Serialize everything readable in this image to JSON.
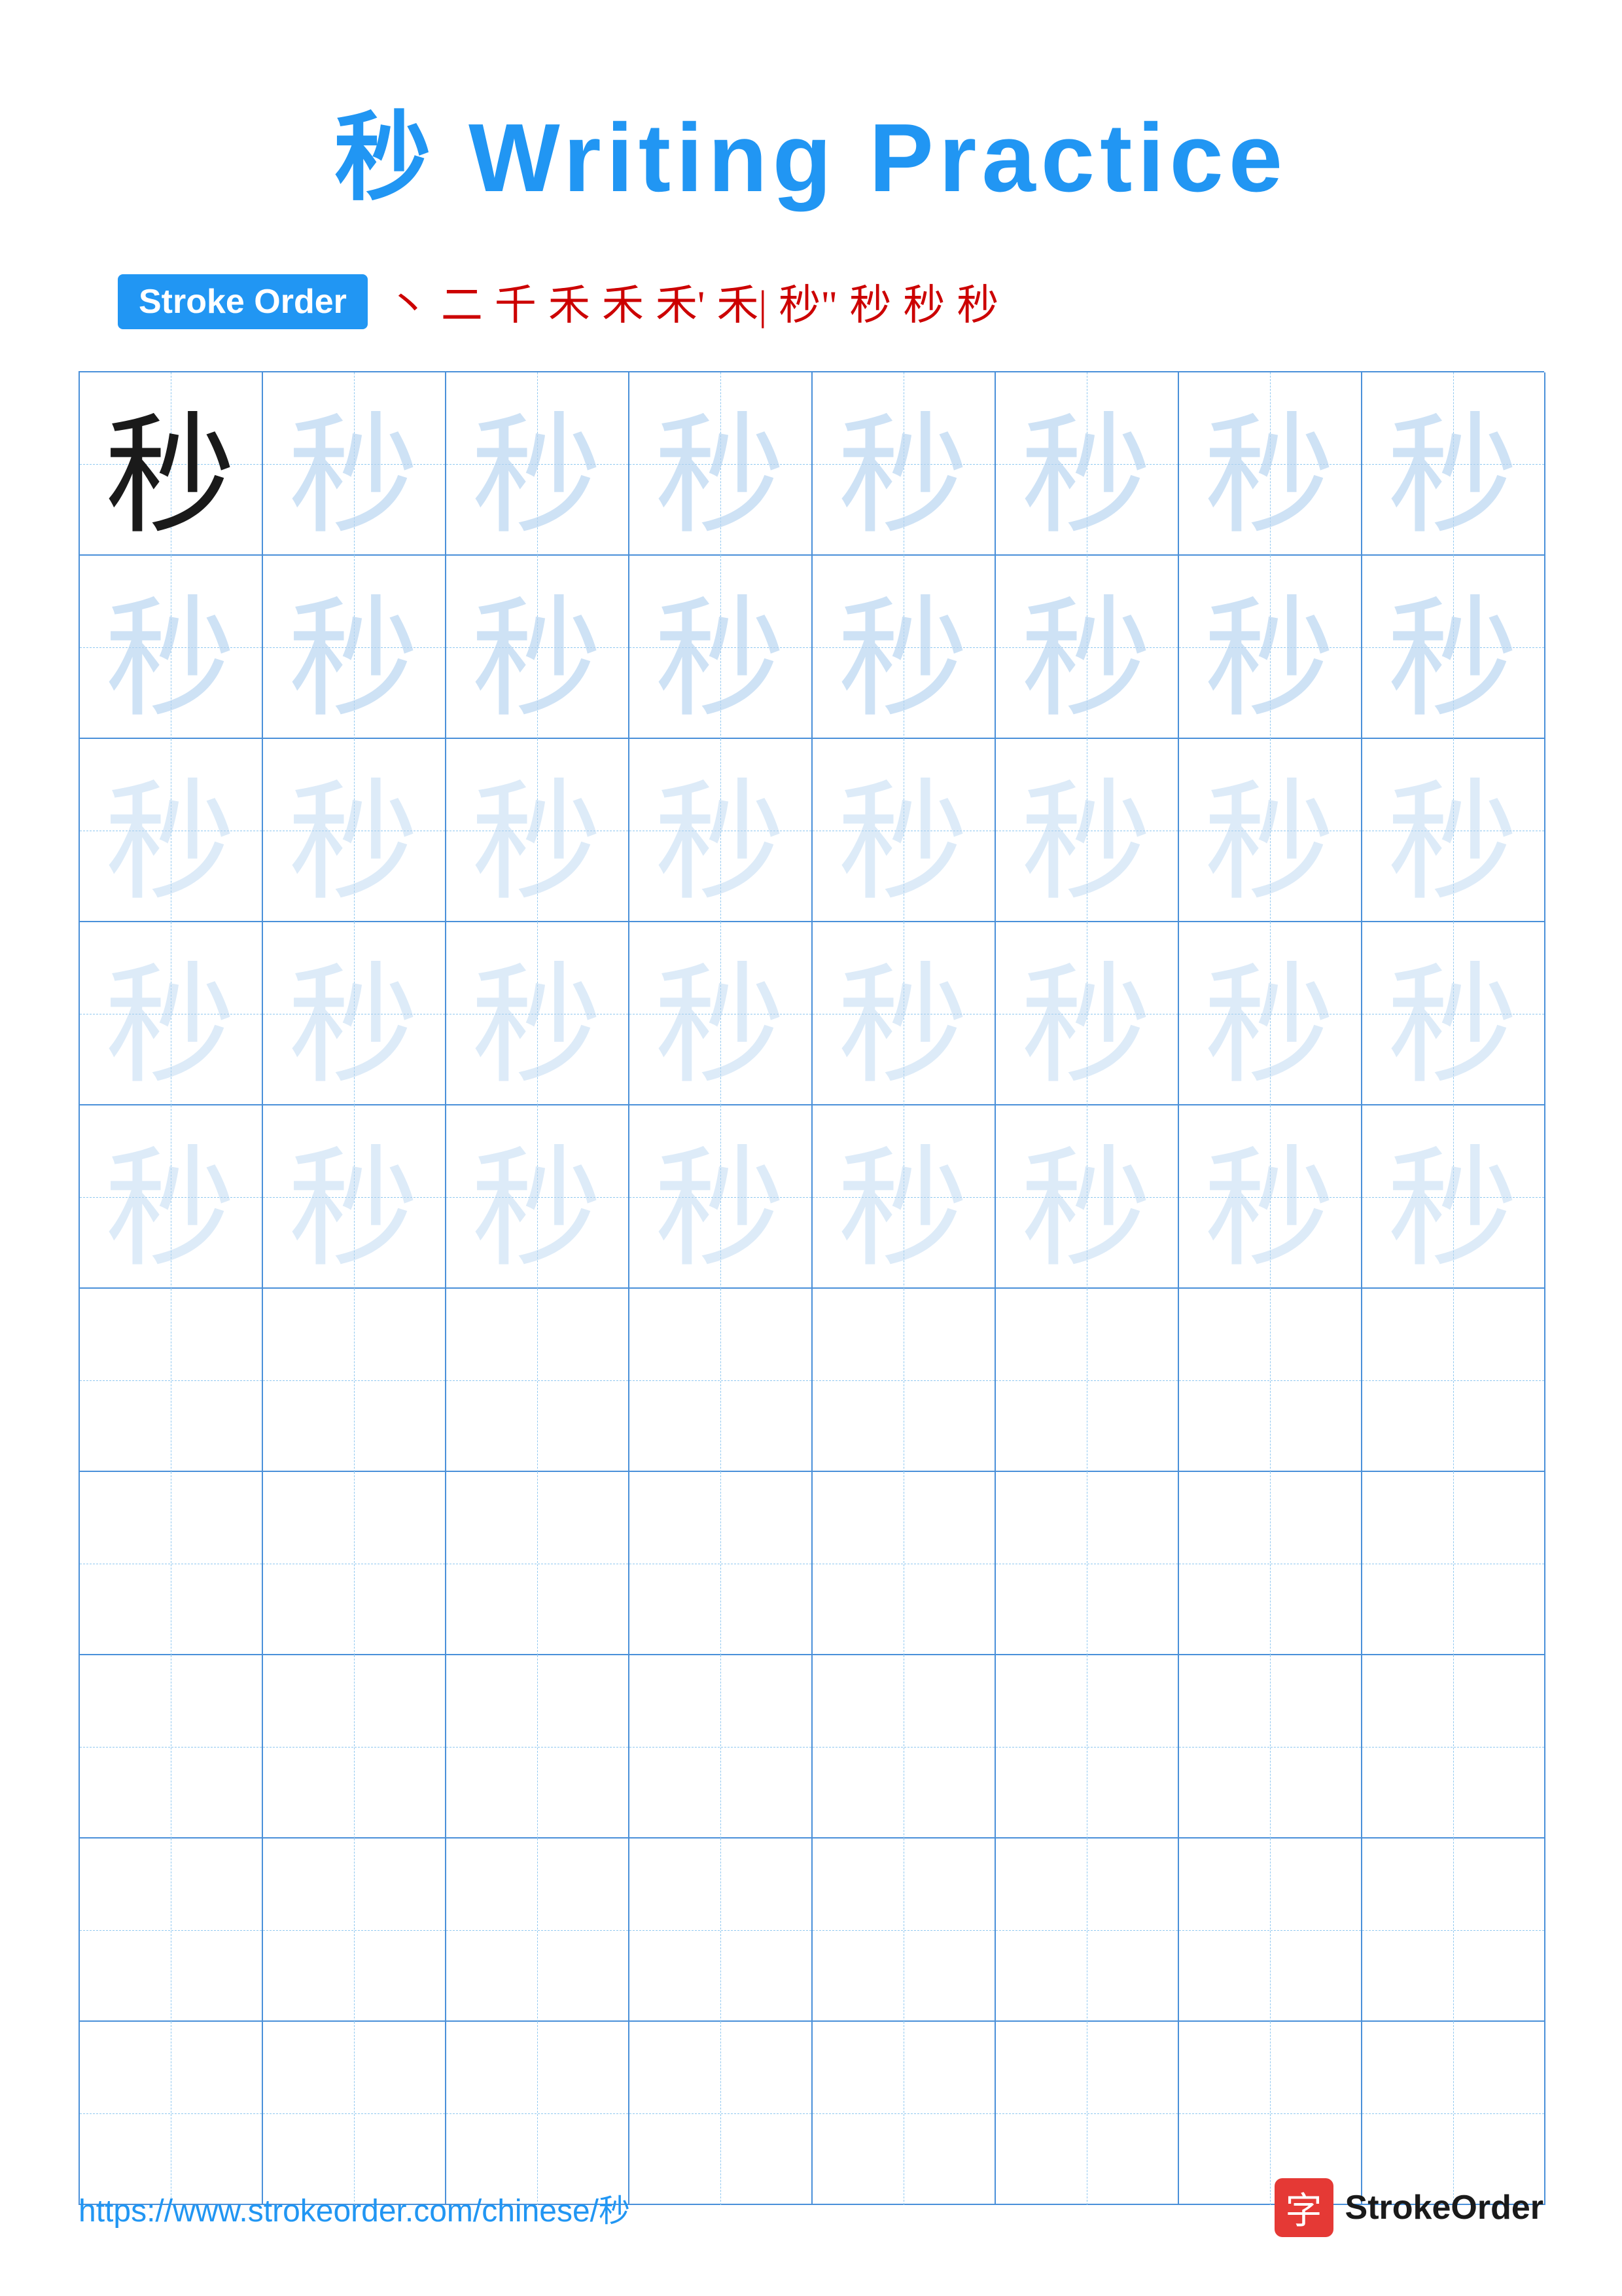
{
  "title": "秒 Writing Practice",
  "stroke_order": {
    "badge_label": "Stroke Order",
    "chars": [
      "丶",
      "二",
      "千",
      "禾",
      "禾",
      "禾'",
      "禾|",
      "秒\"",
      "秒",
      "秒",
      "秒"
    ]
  },
  "main_char": "秒",
  "grid": {
    "rows": 10,
    "cols": 8,
    "guide_rows": 5,
    "empty_rows": 5
  },
  "footer": {
    "url": "https://www.strokeorder.com/chinese/秒",
    "brand_char": "字",
    "brand_name": "StrokeOrder"
  }
}
